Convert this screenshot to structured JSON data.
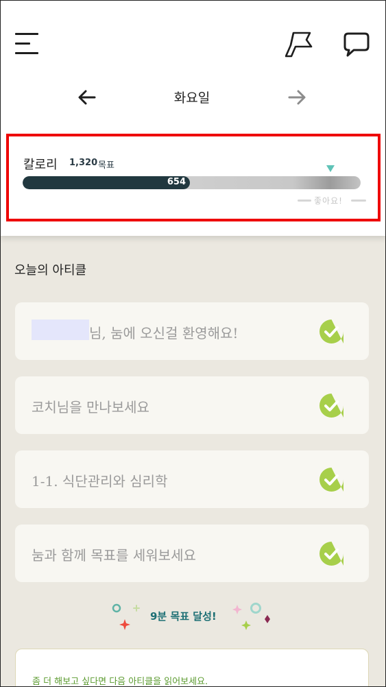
{
  "header": {
    "menu_icon": "hamburger-menu-icon",
    "flag_icon": "flag-icon",
    "chat_icon": "chat-bubble-icon"
  },
  "day_nav": {
    "title": "화요일",
    "prev_icon": "arrow-left-icon",
    "next_icon": "arrow-right-icon"
  },
  "calories": {
    "label": "칼로리",
    "goal": "1,320",
    "goal_label": "목표",
    "value": "654",
    "progress_fraction": 0.4955,
    "good_label": "좋아요!",
    "bar_color": "#21383f",
    "marker_color": "#5fc3b7"
  },
  "articles": {
    "section_title": "오늘의 아티클",
    "items": [
      {
        "text": "님, 눔에 오신걸 환영해요!",
        "completed": true
      },
      {
        "text": "코치님을 만나보세요",
        "completed": true
      },
      {
        "text": "1-1. 식단관리와 심리학",
        "completed": true
      },
      {
        "text": "눔과 함께 목표를 세워보세요",
        "completed": true
      }
    ],
    "check_color": "#a7cf4a"
  },
  "achievement": {
    "text": "9분 목표 달성!"
  },
  "next_article": {
    "text": "좀 더 해보고 싶다면 다음 아티클을 읽어보세요."
  }
}
